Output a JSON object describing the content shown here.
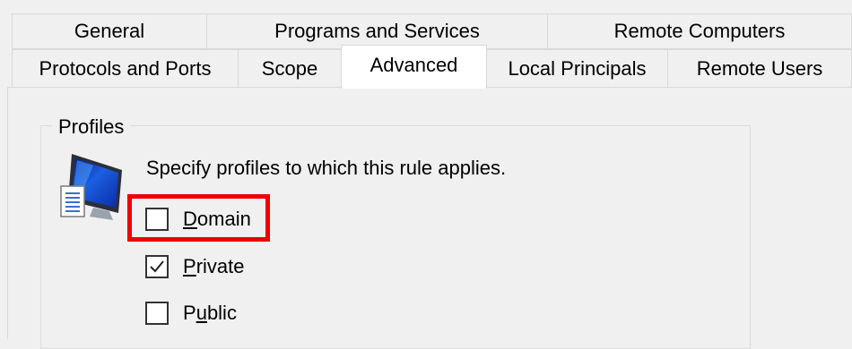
{
  "tabs_top": [
    "General",
    "Programs and Services",
    "Remote Computers"
  ],
  "tabs_bottom": [
    "Protocols and Ports",
    "Scope",
    "Advanced",
    "Local Principals",
    "Remote Users"
  ],
  "active_tab": "Advanced",
  "profiles": {
    "group_label": "Profiles",
    "description": "Specify profiles to which this rule applies.",
    "icon": "computer-monitor-icon",
    "options": [
      {
        "label": "Domain",
        "mnemonic": "D",
        "rest": "omain",
        "checked": false,
        "highlighted": true
      },
      {
        "label": "Private",
        "mnemonic": "P",
        "rest": "rivate",
        "checked": true,
        "highlighted": false
      },
      {
        "label": "Public",
        "mnemonic": "u",
        "pre": "P",
        "rest": "blic",
        "checked": false,
        "highlighted": false
      }
    ]
  },
  "colors": {
    "highlight": "#ee0000",
    "window_bg": "#f0f0f0",
    "active_tab_bg": "#ffffff"
  }
}
